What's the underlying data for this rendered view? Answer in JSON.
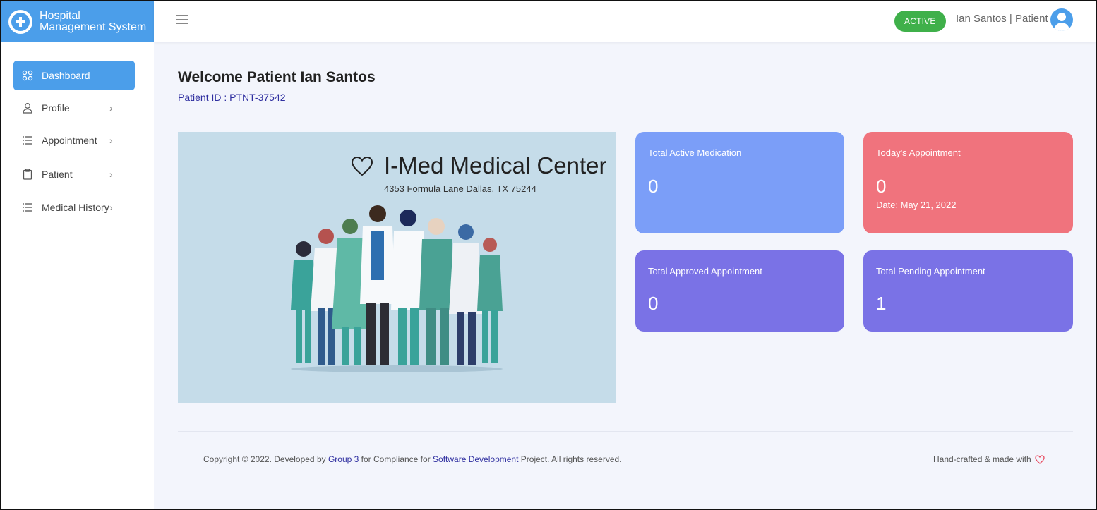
{
  "brand": {
    "line1": "Hospital",
    "line2": "Management System"
  },
  "topbar": {
    "status": "ACTIVE",
    "user": "Ian Santos | Patient"
  },
  "sidebar": {
    "items": [
      {
        "label": "Dashboard",
        "icon": "grid-icon",
        "active": true
      },
      {
        "label": "Profile",
        "icon": "user-icon",
        "chevron": "›"
      },
      {
        "label": "Appointment",
        "icon": "list-icon",
        "chevron": "›"
      },
      {
        "label": "Patient",
        "icon": "clipboard-icon",
        "chevron": "›"
      },
      {
        "label": "Medical History",
        "icon": "list-icon",
        "chevron": "›"
      }
    ]
  },
  "main": {
    "welcome": "Welcome Patient Ian Santos",
    "patient_id": "Patient ID : PTNT-37542",
    "banner": {
      "title": "I-Med Medical Center",
      "address": "4353 Formula Lane Dallas, TX 75244",
      "icon": "heart-icon"
    },
    "cards": [
      {
        "label": "Total Active Medication",
        "value": "0",
        "color": "#7b9ef8"
      },
      {
        "label": "Today's Appointment",
        "value": "0",
        "sub": "Date: May 21, 2022",
        "color": "#f0737d"
      },
      {
        "label": "Total Approved Appointment",
        "value": "0",
        "color": "#7a72e6"
      },
      {
        "label": "Total Pending Appointment",
        "value": "1",
        "color": "#7a72e6"
      }
    ]
  },
  "footer": {
    "copy_pre": "Copyright © 2022. Developed by ",
    "link1": "Group 3",
    "copy_mid": " for Compliance for ",
    "link2": "Software Development",
    "copy_post": " Project. All rights reserved.",
    "credit": "Hand-crafted & made with"
  },
  "colors": {
    "accent": "#4b9eea",
    "active_badge": "#3fb04a",
    "banner_bg": "#c5dce9",
    "card_blue": "#7b9ef8",
    "card_red": "#f0737d",
    "card_purple": "#7a72e6"
  }
}
